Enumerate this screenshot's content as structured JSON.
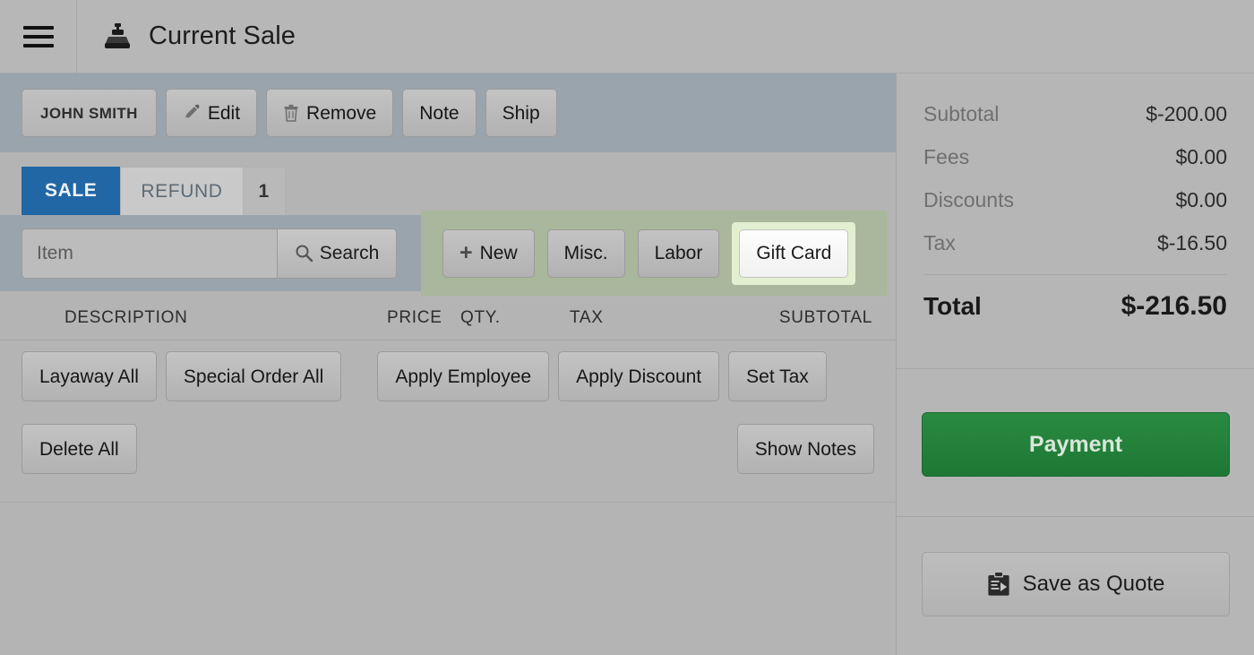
{
  "header": {
    "menu_icon": "hamburger-menu-icon",
    "app_icon": "cash-register-icon",
    "title": "Current Sale"
  },
  "customer_toolbar": {
    "customer_name": "JOHN SMITH",
    "edit_label": "Edit",
    "edit_icon": "pencil-icon",
    "remove_label": "Remove",
    "remove_icon": "trash-icon",
    "note_label": "Note",
    "ship_label": "Ship"
  },
  "tabs": {
    "sale_label": "SALE",
    "refund_label": "REFUND",
    "refund_count": "1",
    "active": "SALE",
    "active_color": "#2167a5"
  },
  "search": {
    "placeholder": "Item",
    "value": "",
    "button_label": "Search",
    "button_icon": "magnifier-icon"
  },
  "quick_add": {
    "highlight_color": "#a9b79c",
    "focus_color": "#e2f0d1",
    "new_label": "New",
    "new_icon": "plus-icon",
    "misc_label": "Misc.",
    "labor_label": "Labor",
    "gift_card_label": "Gift Card",
    "focused_button": "Gift Card"
  },
  "line_items_table": {
    "columns": [
      "DESCRIPTION",
      "PRICE",
      "QTY.",
      "TAX",
      "SUBTOTAL"
    ],
    "rows": []
  },
  "actions": {
    "layaway_all": "Layaway All",
    "special_order_all": "Special Order All",
    "apply_employee": "Apply Employee",
    "apply_discount": "Apply Discount",
    "set_tax": "Set Tax",
    "delete_all": "Delete All",
    "show_notes": "Show Notes"
  },
  "sidebar": {
    "totals": [
      {
        "label": "Subtotal",
        "value": "$-200.00"
      },
      {
        "label": "Fees",
        "value": "$0.00"
      },
      {
        "label": "Discounts",
        "value": "$0.00"
      },
      {
        "label": "Tax",
        "value": "$-16.50"
      }
    ],
    "grand_total_label": "Total",
    "grand_total_value": "$-216.50",
    "payment_label": "Payment",
    "payment_color": "#1d7834",
    "quote_label": "Save as Quote",
    "quote_icon": "clipboard-quote-icon"
  }
}
